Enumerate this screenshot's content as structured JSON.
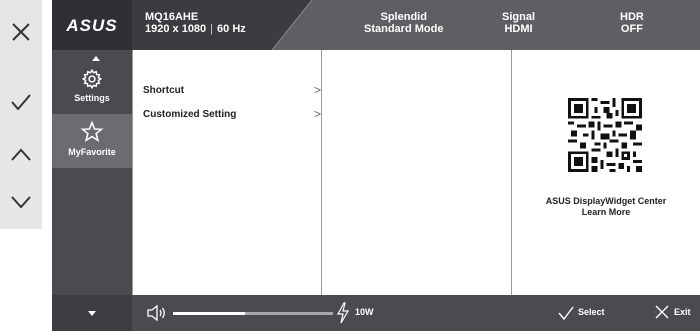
{
  "keys": [
    {
      "icon": "close-icon"
    },
    {
      "icon": "check-icon"
    },
    {
      "icon": "chevron-up-icon"
    },
    {
      "icon": "chevron-down-icon"
    }
  ],
  "header": {
    "brand": "ASUS",
    "model": "MQ16AHE",
    "resolution": "1920 x 1080",
    "refresh": "60 Hz",
    "splendid_label": "Splendid",
    "splendid_value": "Standard Mode",
    "signal_label": "Signal",
    "signal_value": "HDMI",
    "hdr_label": "HDR",
    "hdr_value": "OFF"
  },
  "sidebar": {
    "items": [
      {
        "label": "Settings",
        "icon": "gear-icon",
        "selected": false
      },
      {
        "label": "MyFavorite",
        "icon": "star-icon",
        "selected": true
      }
    ]
  },
  "menu": {
    "items": [
      {
        "label": "Shortcut",
        "chevron": ">"
      },
      {
        "label": "Customized Setting",
        "chevron": ">"
      }
    ]
  },
  "info": {
    "qr_icon": "qr-code-icon",
    "title": "ASUS DisplayWidget Center",
    "link": "Learn More"
  },
  "footer": {
    "volume_icon": "speaker-icon",
    "volume_level": 0.45,
    "power_icon": "lightning-icon",
    "power": "10W",
    "select_label": "Select",
    "exit_label": "Exit"
  },
  "colors": {
    "header": "#5e5f62",
    "brand_block": "#2f3033",
    "sidebar": "#4a4b4e",
    "selected_tab": "#6b6c70",
    "key_strip": "#e6e6e6"
  }
}
